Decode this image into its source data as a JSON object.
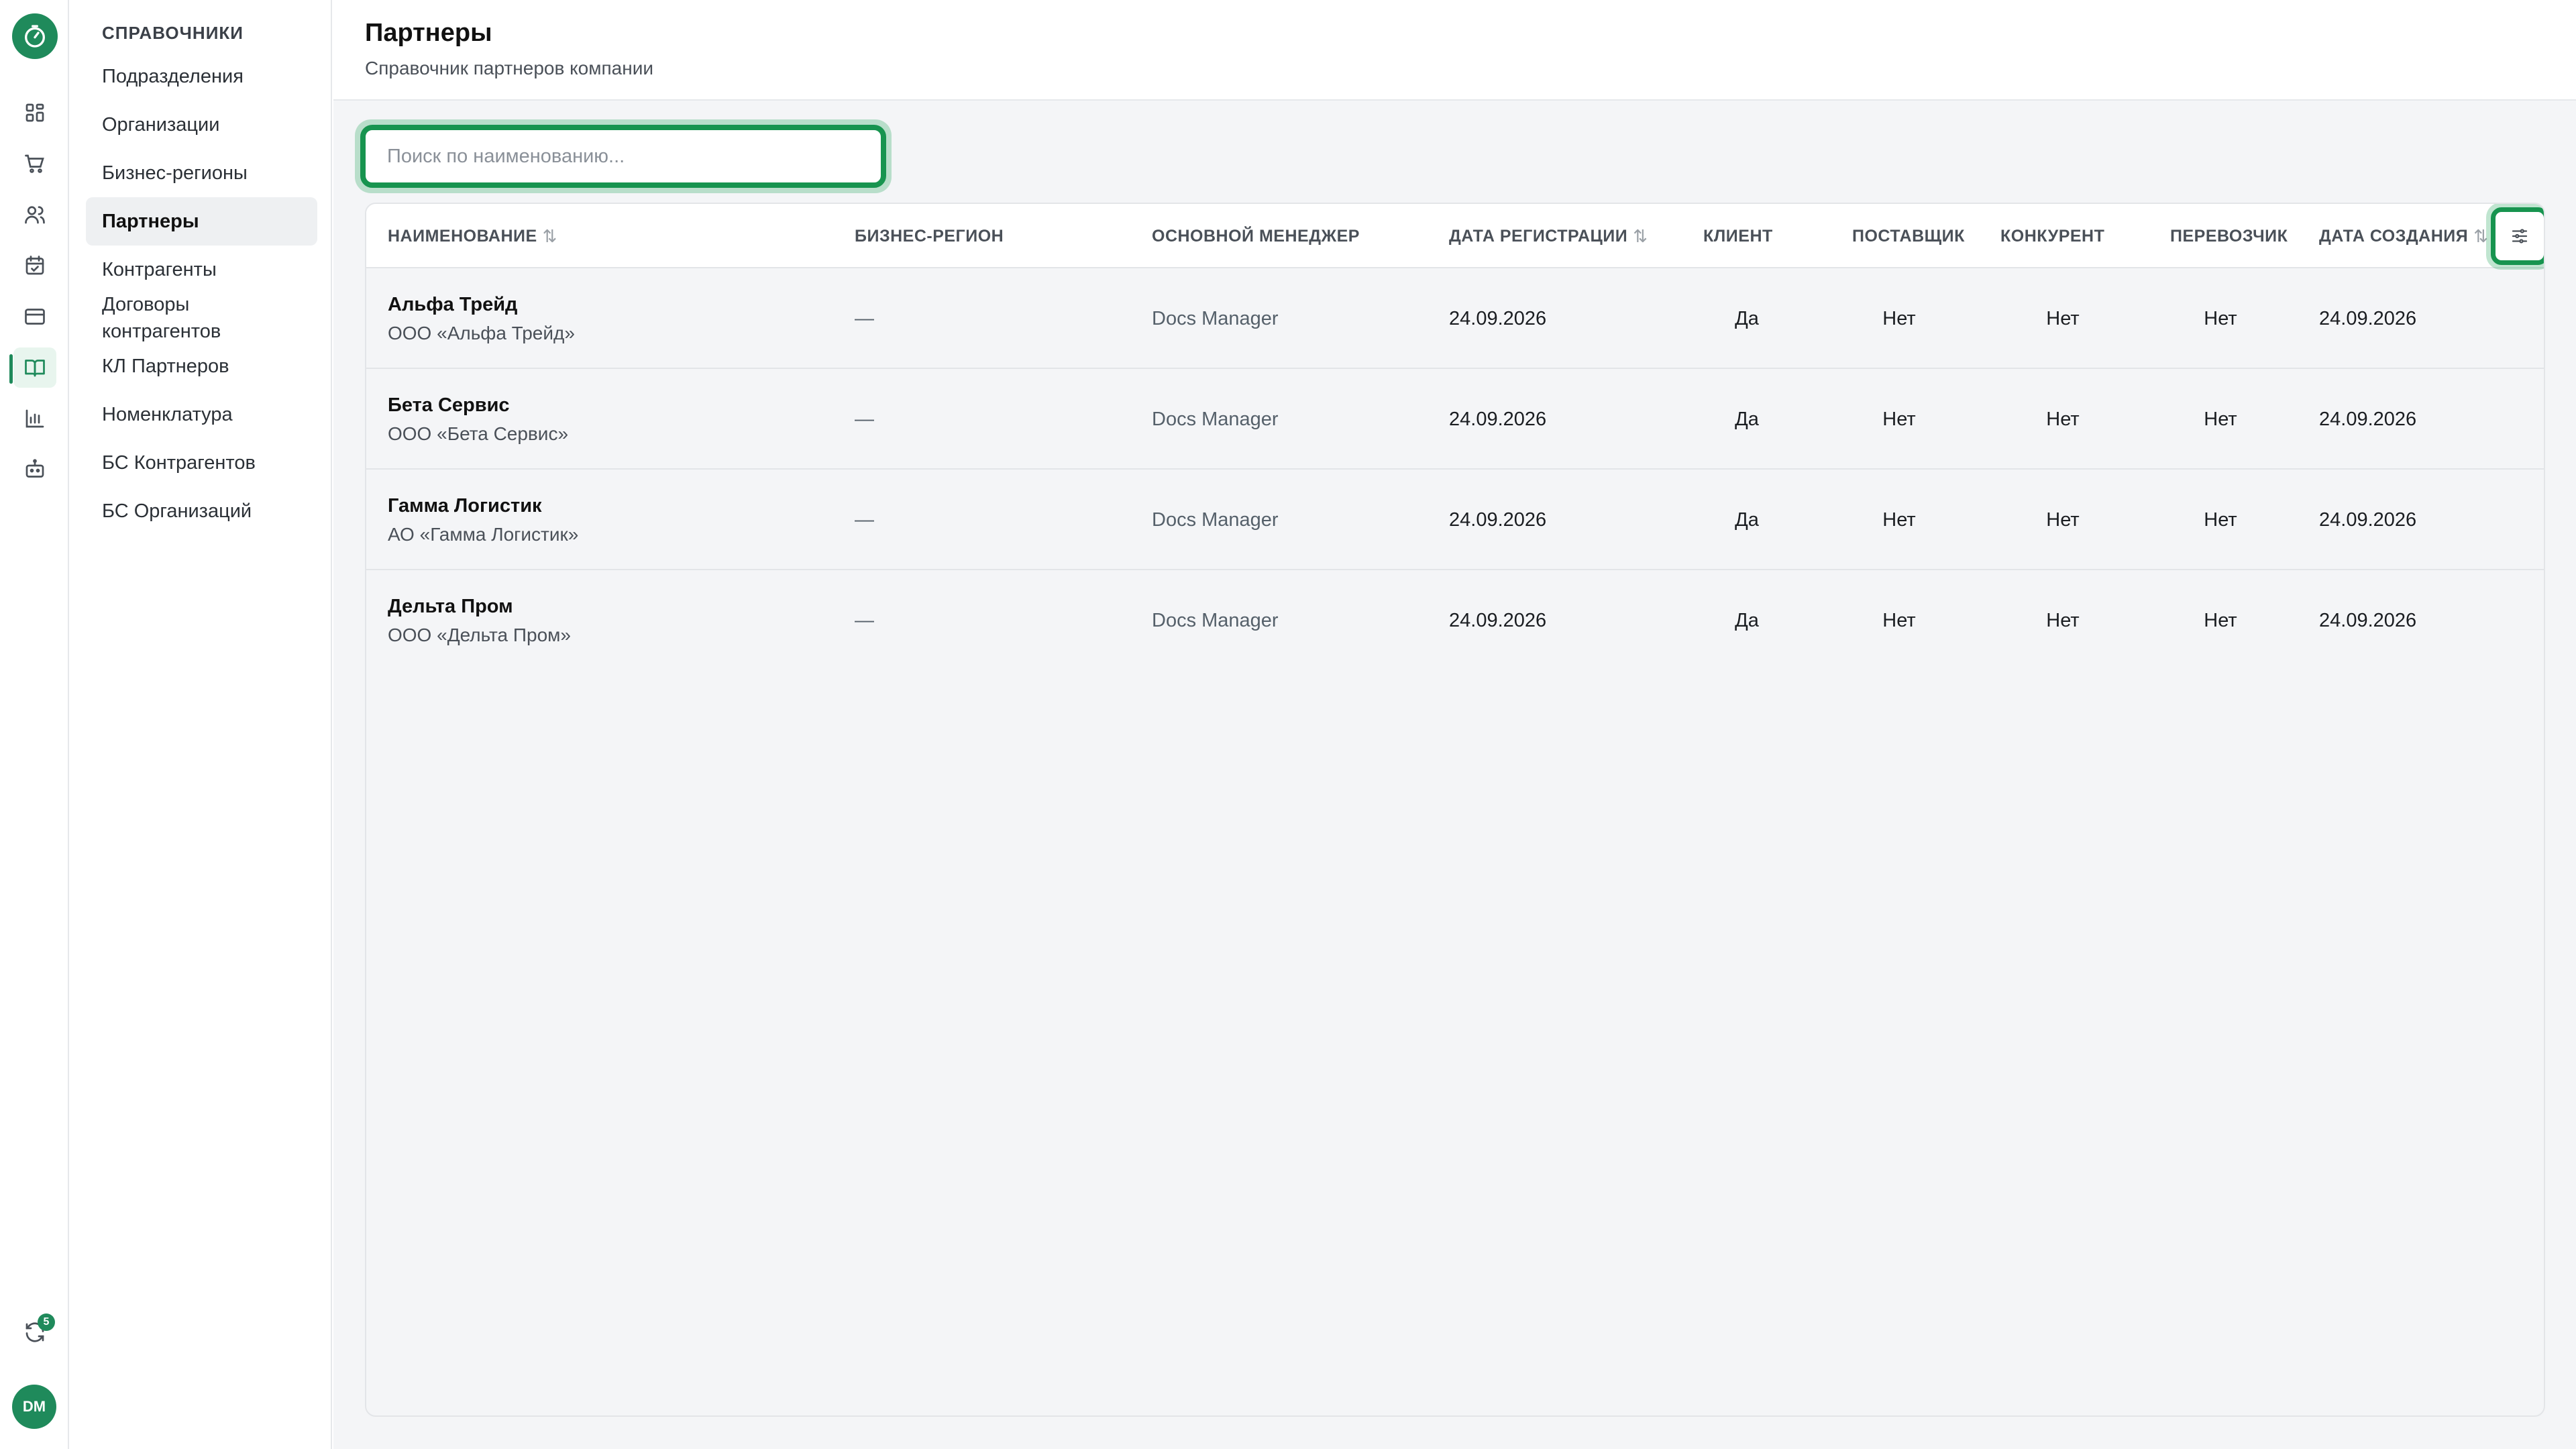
{
  "rail": {
    "icons": [
      "timer-icon",
      "dashboard-icon",
      "cart-icon",
      "users-icon",
      "calendar-icon",
      "card-icon",
      "book-icon",
      "chart-icon",
      "bot-icon"
    ],
    "active": "book-icon",
    "sync_badge": "5",
    "avatar": "DM",
    "accent": "#1f8a5b"
  },
  "sidebar": {
    "heading": "СПРАВОЧНИКИ",
    "items": [
      {
        "label": "Подразделения"
      },
      {
        "label": "Организации"
      },
      {
        "label": "Бизнес-регионы"
      },
      {
        "label": "Партнеры",
        "active": true
      },
      {
        "label": "Контрагенты"
      },
      {
        "label": "Договоры контрагентов"
      },
      {
        "label": "КЛ Партнеров"
      },
      {
        "label": "Номенклатура"
      },
      {
        "label": "БС Контрагентов"
      },
      {
        "label": "БС Организаций"
      }
    ]
  },
  "header": {
    "title": "Партнеры",
    "subtitle": "Справочник партнеров компании"
  },
  "search": {
    "placeholder": "Поиск по наименованию...",
    "value": ""
  },
  "table": {
    "columns": [
      {
        "label": "НАИМЕНОВАНИЕ",
        "sortable": true
      },
      {
        "label": "БИЗНЕС-РЕГИОН",
        "sortable": false
      },
      {
        "label": "ОСНОВНОЙ МЕНЕДЖЕР",
        "sortable": false
      },
      {
        "label": "ДАТА РЕГИСТРАЦИИ",
        "sortable": true
      },
      {
        "label": "КЛИЕНТ",
        "sortable": false
      },
      {
        "label": "ПОСТАВЩИК",
        "sortable": false
      },
      {
        "label": "КОНКУРЕНТ",
        "sortable": false
      },
      {
        "label": "ПЕРЕВОЗЧИК",
        "sortable": false
      },
      {
        "label": "ДАТА СОЗДАНИЯ",
        "sortable": true
      }
    ],
    "rows": [
      {
        "name": "Альфа Трейд",
        "legal": "ООО «Альфа Трейд»",
        "region": "—",
        "manager": "Docs Manager",
        "reg_date": "24.09.2026",
        "client": "Да",
        "supplier": "Нет",
        "competitor": "Нет",
        "carrier": "Нет",
        "created": "24.09.2026"
      },
      {
        "name": "Бета Сервис",
        "legal": "ООО «Бета Сервис»",
        "region": "—",
        "manager": "Docs Manager",
        "reg_date": "24.09.2026",
        "client": "Да",
        "supplier": "Нет",
        "competitor": "Нет",
        "carrier": "Нет",
        "created": "24.09.2026"
      },
      {
        "name": "Гамма Логистик",
        "legal": "АО «Гамма Логистик»",
        "region": "—",
        "manager": "Docs Manager",
        "reg_date": "24.09.2026",
        "client": "Да",
        "supplier": "Нет",
        "competitor": "Нет",
        "carrier": "Нет",
        "created": "24.09.2026"
      },
      {
        "name": "Дельта Пром",
        "legal": "ООО «Дельта Пром»",
        "region": "—",
        "manager": "Docs Manager",
        "reg_date": "24.09.2026",
        "client": "Да",
        "supplier": "Нет",
        "competitor": "Нет",
        "carrier": "Нет",
        "created": "24.09.2026"
      }
    ]
  }
}
